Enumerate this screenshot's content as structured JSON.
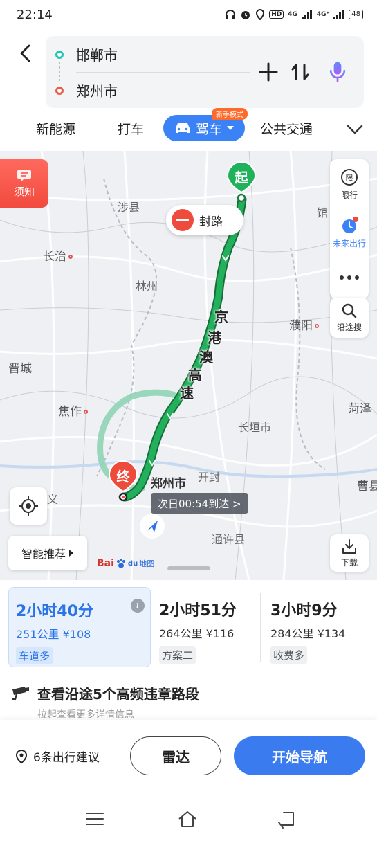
{
  "status_bar": {
    "time": "22:14",
    "battery": "48",
    "net1": "4G",
    "net2": "4G⁺",
    "hd": "HD"
  },
  "route": {
    "origin": "邯郸市",
    "destination": "郑州市"
  },
  "tabs": {
    "items": [
      "新能源",
      "打车",
      "驾车",
      "公共交通"
    ],
    "active_badge": "新手模式"
  },
  "map": {
    "notice_label": "须知",
    "start_label": "起",
    "end_label": "终",
    "closure_label": "封路",
    "highway": [
      "京",
      "港",
      "澳",
      "高",
      "速"
    ],
    "eta": "次日00:54到达 >",
    "cities": [
      "长治",
      "林州",
      "濮阳",
      "晋城",
      "焦作",
      "长垣市",
      "郑州市",
      "开封",
      "通许县",
      "菏泽",
      "曹县",
      "馆",
      "涉县",
      "义"
    ],
    "right_panel": {
      "restriction": "限行",
      "future_trip": "未来出行",
      "search_along": "沿途搜",
      "download": "下载"
    },
    "smart_recommend": "智能推荐",
    "logo_text": "Bai",
    "logo_suffix": "du",
    "logo_map": "地图"
  },
  "options": [
    {
      "duration": "2小时40分",
      "meta": "251公里 ¥108",
      "tag": "车道多"
    },
    {
      "duration": "2小时51分",
      "meta": "264公里 ¥116",
      "tag": "方案二"
    },
    {
      "duration": "3小时9分",
      "meta": "284公里 ¥134",
      "tag": "收费多"
    }
  ],
  "info_icon_text": "i",
  "violation": {
    "title": "查看沿途5个高频违章路段",
    "subtitle": "拉起查看更多详情信息"
  },
  "actions": {
    "tips": "6条出行建议",
    "radar": "雷达",
    "start_nav": "开始导航"
  },
  "colors": {
    "accent": "#3b82f6",
    "route_green": "#22a656",
    "alt_route": "#7fcfae",
    "end_red": "#ee4b3c"
  }
}
